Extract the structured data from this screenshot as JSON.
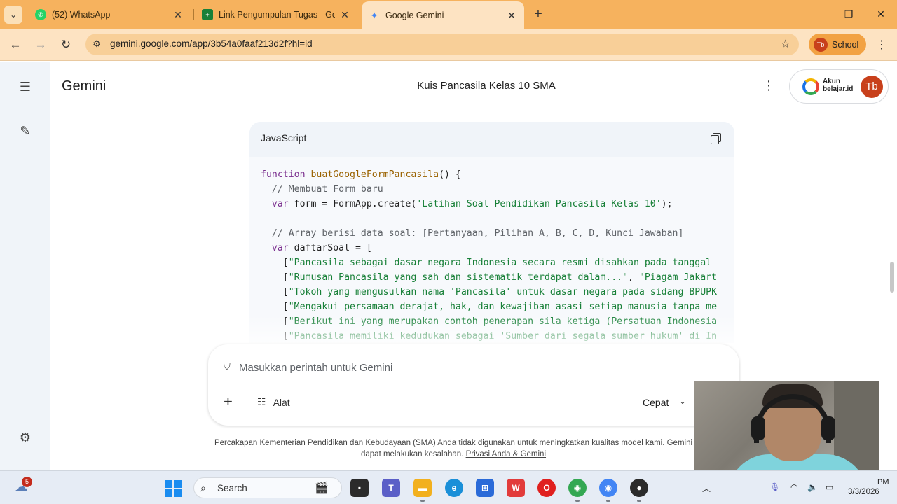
{
  "browser": {
    "tab_menu_icon": "chevron-down",
    "tabs": [
      {
        "title": "(52) WhatsApp",
        "icon": "whatsapp-icon",
        "color": "#25d366"
      },
      {
        "title": "Link Pengumpulan Tugas - Goo",
        "icon": "sheets-icon",
        "color": "#188038"
      },
      {
        "title": "Google Gemini",
        "icon": "gemini-icon",
        "color": "#4285f4",
        "active": true
      }
    ],
    "url": "gemini.google.com/app/3b54a0faaf213d2f?hl=id",
    "profile_initials": "Tb",
    "profile_label": "School"
  },
  "app": {
    "name": "Gemini",
    "chat_title": "Kuis Pancasila Kelas 10 SMA",
    "account": {
      "brand_line1": "Akun",
      "brand_line2": "belajar.id",
      "avatar_initials": "Tb"
    }
  },
  "code_block": {
    "language": "JavaScript",
    "lines": [
      {
        "parts": [
          {
            "t": "function ",
            "c": "kw"
          },
          {
            "t": "buatGoogleFormPancasila",
            "c": "fn"
          },
          {
            "t": "() {",
            "c": ""
          }
        ]
      },
      {
        "parts": [
          {
            "t": "  // Membuat Form baru",
            "c": "cm"
          }
        ]
      },
      {
        "parts": [
          {
            "t": "  var ",
            "c": "kw"
          },
          {
            "t": "form = FormApp.create(",
            "c": ""
          },
          {
            "t": "'Latihan Soal Pendidikan Pancasila Kelas 10'",
            "c": "st"
          },
          {
            "t": ");",
            "c": ""
          }
        ]
      },
      {
        "parts": [
          {
            "t": "",
            "c": ""
          }
        ]
      },
      {
        "parts": [
          {
            "t": "  // Array berisi data soal: [Pertanyaan, Pilihan A, B, C, D, Kunci Jawaban]",
            "c": "cm"
          }
        ]
      },
      {
        "parts": [
          {
            "t": "  var ",
            "c": "kw"
          },
          {
            "t": "daftarSoal = [",
            "c": ""
          }
        ]
      },
      {
        "parts": [
          {
            "t": "    [",
            "c": ""
          },
          {
            "t": "\"Pancasila sebagai dasar negara Indonesia secara resmi disahkan pada tanggal",
            "c": "st"
          }
        ]
      },
      {
        "parts": [
          {
            "t": "    [",
            "c": ""
          },
          {
            "t": "\"Rumusan Pancasila yang sah dan sistematik terdapat dalam...\"",
            "c": "st"
          },
          {
            "t": ", ",
            "c": ""
          },
          {
            "t": "\"Piagam Jakart",
            "c": "st"
          }
        ]
      },
      {
        "parts": [
          {
            "t": "    [",
            "c": ""
          },
          {
            "t": "\"Tokoh yang mengusulkan nama 'Pancasila' untuk dasar negara pada sidang BPUPK",
            "c": "st"
          }
        ]
      },
      {
        "parts": [
          {
            "t": "    [",
            "c": ""
          },
          {
            "t": "\"Mengakui persamaan derajat, hak, dan kewajiban asasi setiap manusia tanpa me",
            "c": "st"
          }
        ]
      },
      {
        "parts": [
          {
            "t": "    [",
            "c": ""
          },
          {
            "t": "\"Berikut ini yang merupakan contoh penerapan sila ketiga (Persatuan Indonesia",
            "c": "st"
          }
        ]
      },
      {
        "parts": [
          {
            "t": "    [",
            "c": ""
          },
          {
            "t": "\"Pancasila memiliki kedudukan sebagai 'Sumber dari segala sumber hukum' di In",
            "c": "st"
          }
        ]
      }
    ]
  },
  "prompt": {
    "placeholder": "Masukkan perintah untuk Gemini",
    "tools_label": "Alat",
    "mode_label": "Cepat"
  },
  "disclaimer": {
    "line1": "Percakapan Kementerian Pendidikan dan Kebudayaan (SMA) Anda tidak digunakan untuk meningkatkan kualitas model kami. Gemini",
    "line2_prefix": "dapat melakukan kesalahan. ",
    "link": "Privasi Anda & Gemini"
  },
  "taskbar": {
    "weather_badge": "5",
    "search_label": "Search",
    "apps": [
      {
        "name": "file-explorer-black",
        "color": "#2b2b2b"
      },
      {
        "name": "teams",
        "color": "#5b5fc7"
      },
      {
        "name": "file-explorer",
        "color": "#f2b01e"
      },
      {
        "name": "edge",
        "color": "#1a8fd8"
      },
      {
        "name": "store",
        "color": "#2a6ad8"
      },
      {
        "name": "wps",
        "color": "#e23b3b"
      },
      {
        "name": "opera",
        "color": "#e0201f"
      },
      {
        "name": "chrome-profile-tb",
        "color": "#34a853"
      },
      {
        "name": "chrome",
        "color": "#4285f4"
      },
      {
        "name": "obs",
        "color": "#2b2b2b"
      }
    ],
    "time": "PM",
    "date": "3/3/2026"
  }
}
